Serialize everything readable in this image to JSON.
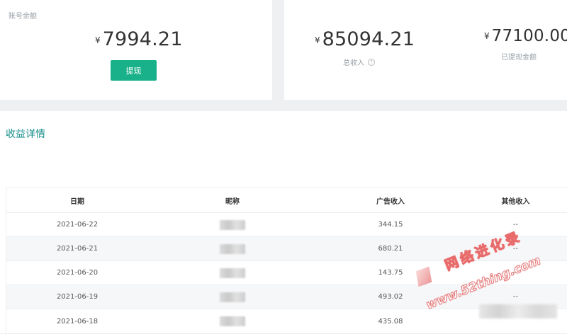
{
  "balance_card": {
    "label": "账号余额",
    "currency": "¥",
    "amount": "7994.21",
    "withdraw_button": "提现"
  },
  "income_card": {
    "total": {
      "currency": "¥",
      "amount": "85094.21",
      "label": "总收入"
    },
    "withdrawn": {
      "currency": "¥",
      "amount": "77100.00",
      "label": "已提现金额"
    },
    "help_icon": "?"
  },
  "details": {
    "title": "收益详情",
    "columns": [
      "日期",
      "昵称",
      "广告收入",
      "其他收入"
    ],
    "rows": [
      {
        "date": "2021-06-22",
        "ad_income": "344.15",
        "other_income": "--"
      },
      {
        "date": "2021-06-21",
        "ad_income": "680.21",
        "other_income": "--"
      },
      {
        "date": "2021-06-20",
        "ad_income": "143.75",
        "other_income": "--"
      },
      {
        "date": "2021-06-19",
        "ad_income": "493.02",
        "other_income": "--"
      },
      {
        "date": "2021-06-18",
        "ad_income": "435.08",
        "other_income": ""
      }
    ]
  },
  "watermark": {
    "line1": "网络进化录",
    "line2": "www.52thing.com"
  },
  "colors": {
    "accent": "#18b189",
    "title": "#1a8f8c",
    "background": "#eef0f2"
  }
}
